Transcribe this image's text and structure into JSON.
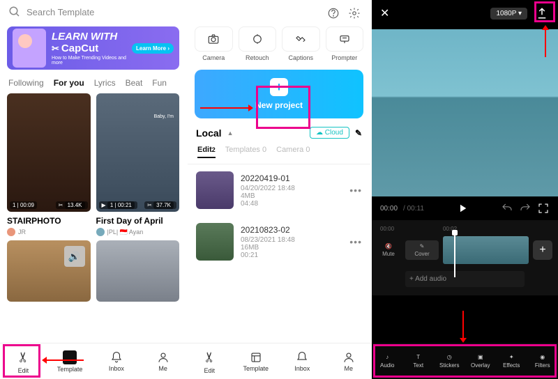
{
  "panel1": {
    "search_placeholder": "Search Template",
    "banner": {
      "line1": "LEARN WITH",
      "line2": "CapCut",
      "sub": "How to Make Trending Videos and more",
      "btn": "Learn More ›"
    },
    "tabs": [
      "Following",
      "For you",
      "Lyrics",
      "Beat",
      "Fun"
    ],
    "cards": [
      {
        "title": "STAIRPHOTO",
        "user": "JR",
        "duration": "1 | 00:09",
        "likes": "13.4K"
      },
      {
        "title": "First Day of April",
        "user": "|PL| 🇮🇩 Ayan",
        "duration": "1 | 00:21",
        "likes": "37.7K",
        "overlay": "Baby, I'm"
      }
    ],
    "nav": [
      {
        "label": "Edit",
        "icon": "scissors"
      },
      {
        "label": "Template",
        "icon": "template"
      },
      {
        "label": "Inbox",
        "icon": "bell"
      },
      {
        "label": "Me",
        "icon": "person"
      }
    ]
  },
  "panel2": {
    "tools": [
      "Camera",
      "Retouch",
      "Captions",
      "Prompter"
    ],
    "new_project": "New project",
    "local": "Local",
    "cloud": "Cloud",
    "subtabs": [
      {
        "label": "Edit",
        "count": "2"
      },
      {
        "label": "Templates",
        "count": "0"
      },
      {
        "label": "Camera",
        "count": "0"
      }
    ],
    "projects": [
      {
        "title": "20220419-01",
        "date": "04/20/2022 18:48",
        "size": "4MB",
        "dur": "04:48"
      },
      {
        "title": "20210823-02",
        "date": "08/23/2021 18:48",
        "size": "16MB",
        "dur": "00:21"
      }
    ],
    "nav": [
      {
        "label": "Edit",
        "icon": "scissors"
      },
      {
        "label": "Template",
        "icon": "template"
      },
      {
        "label": "Inbox",
        "icon": "bell"
      },
      {
        "label": "Me",
        "icon": "person"
      }
    ]
  },
  "panel3": {
    "resolution": "1080P ▾",
    "time_cur": "00:00",
    "time_total": "00:11",
    "ruler": [
      "00:00",
      "00:02"
    ],
    "mute": "Mute",
    "cover": "Cover",
    "add_audio": "+ Add audio",
    "nav": [
      "Audio",
      "Text",
      "Stickers",
      "Overlay",
      "Effects",
      "Filters"
    ]
  }
}
